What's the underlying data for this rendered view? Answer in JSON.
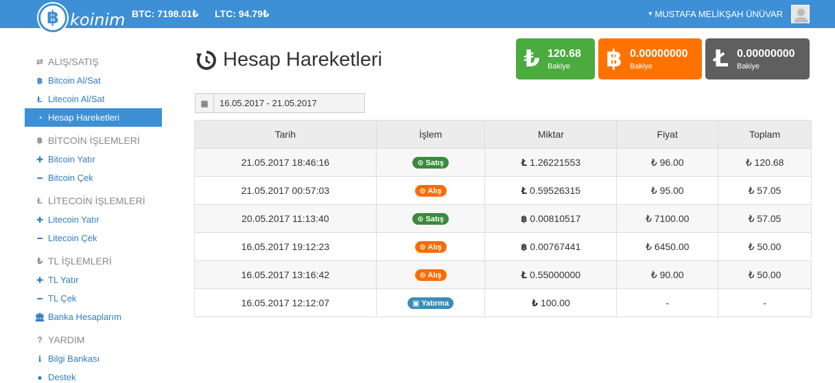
{
  "header": {
    "logo_text": "koinim",
    "logo_symbol": "฿",
    "btc_ticker": "BTC: 7198.01₺",
    "ltc_ticker": "LTC: 94.79₺",
    "user_name": "MUSTAFA MELİKŞAH ÜNÜVAR",
    "caret": "▾",
    "color": "#3d8fd6"
  },
  "sidebar": {
    "trade_head": "ALIŞ/SATIŞ",
    "btc_trade": "Bitcoin Al/Sat",
    "ltc_trade": "Litecoin Al/Sat",
    "history": "Hesap Hareketleri",
    "btc_head": "BİTCOİN İŞLEMLERİ",
    "btc_deposit": "Bitcoin Yatır",
    "btc_withdraw": "Bitcoin Çek",
    "ltc_head": "LİTECOİN İŞLEMLERİ",
    "ltc_deposit": "Litecoin Yatır",
    "ltc_withdraw": "Litecoin Çek",
    "tl_head": "TL İŞLEMLERİ",
    "tl_deposit": "TL Yatır",
    "tl_withdraw": "TL Çek",
    "bank_accounts": "Banka Hesaplarım",
    "help_head": "YARDIM",
    "knowledge_base": "Bilgi Bankası",
    "support": "Destek"
  },
  "page_title": "Hesap Hareketleri",
  "balances": {
    "tl": {
      "symbol": "₺",
      "amount": "120.68",
      "label": "Bakiye",
      "color": "#4aab3e"
    },
    "btc": {
      "symbol": "฿",
      "amount": "0.00000000",
      "label": "Bakiye",
      "color": "#ff7200"
    },
    "ltc": {
      "symbol": "Ł",
      "amount": "0.00000000",
      "label": "Bakiye",
      "color": "#5f5f5f"
    }
  },
  "date_range": {
    "value": "16.05.2017 - 21.05.2017"
  },
  "table": {
    "columns": [
      "Tarih",
      "İşlem",
      "Miktar",
      "Fiyat",
      "Toplam"
    ],
    "rows": [
      {
        "date": "21.05.2017 18:46:16",
        "type": "Satış",
        "cur": "Ł",
        "amount": "1.26221553",
        "price": "₺ 96.00",
        "total": "₺ 120.68"
      },
      {
        "date": "21.05.2017 00:57:03",
        "type": "Alış",
        "cur": "Ł",
        "amount": "0.59526315",
        "price": "₺ 95.00",
        "total": "₺ 57.05"
      },
      {
        "date": "20.05.2017 11:13:40",
        "type": "Satış",
        "cur": "฿",
        "amount": "0.00810517",
        "price": "₺ 7100.00",
        "total": "₺ 57.05"
      },
      {
        "date": "16.05.2017 19:12:23",
        "type": "Alış",
        "cur": "฿",
        "amount": "0.00767441",
        "price": "₺ 6450.00",
        "total": "₺ 50.00"
      },
      {
        "date": "16.05.2017 13:16:42",
        "type": "Alış",
        "cur": "Ł",
        "amount": "0.55000000",
        "price": "₺ 90.00",
        "total": "₺ 50.00"
      },
      {
        "date": "16.05.2017 12:12:07",
        "type": "Yatırma",
        "cur": "₺",
        "amount": "100.00",
        "price": "-",
        "total": "-"
      }
    ]
  }
}
